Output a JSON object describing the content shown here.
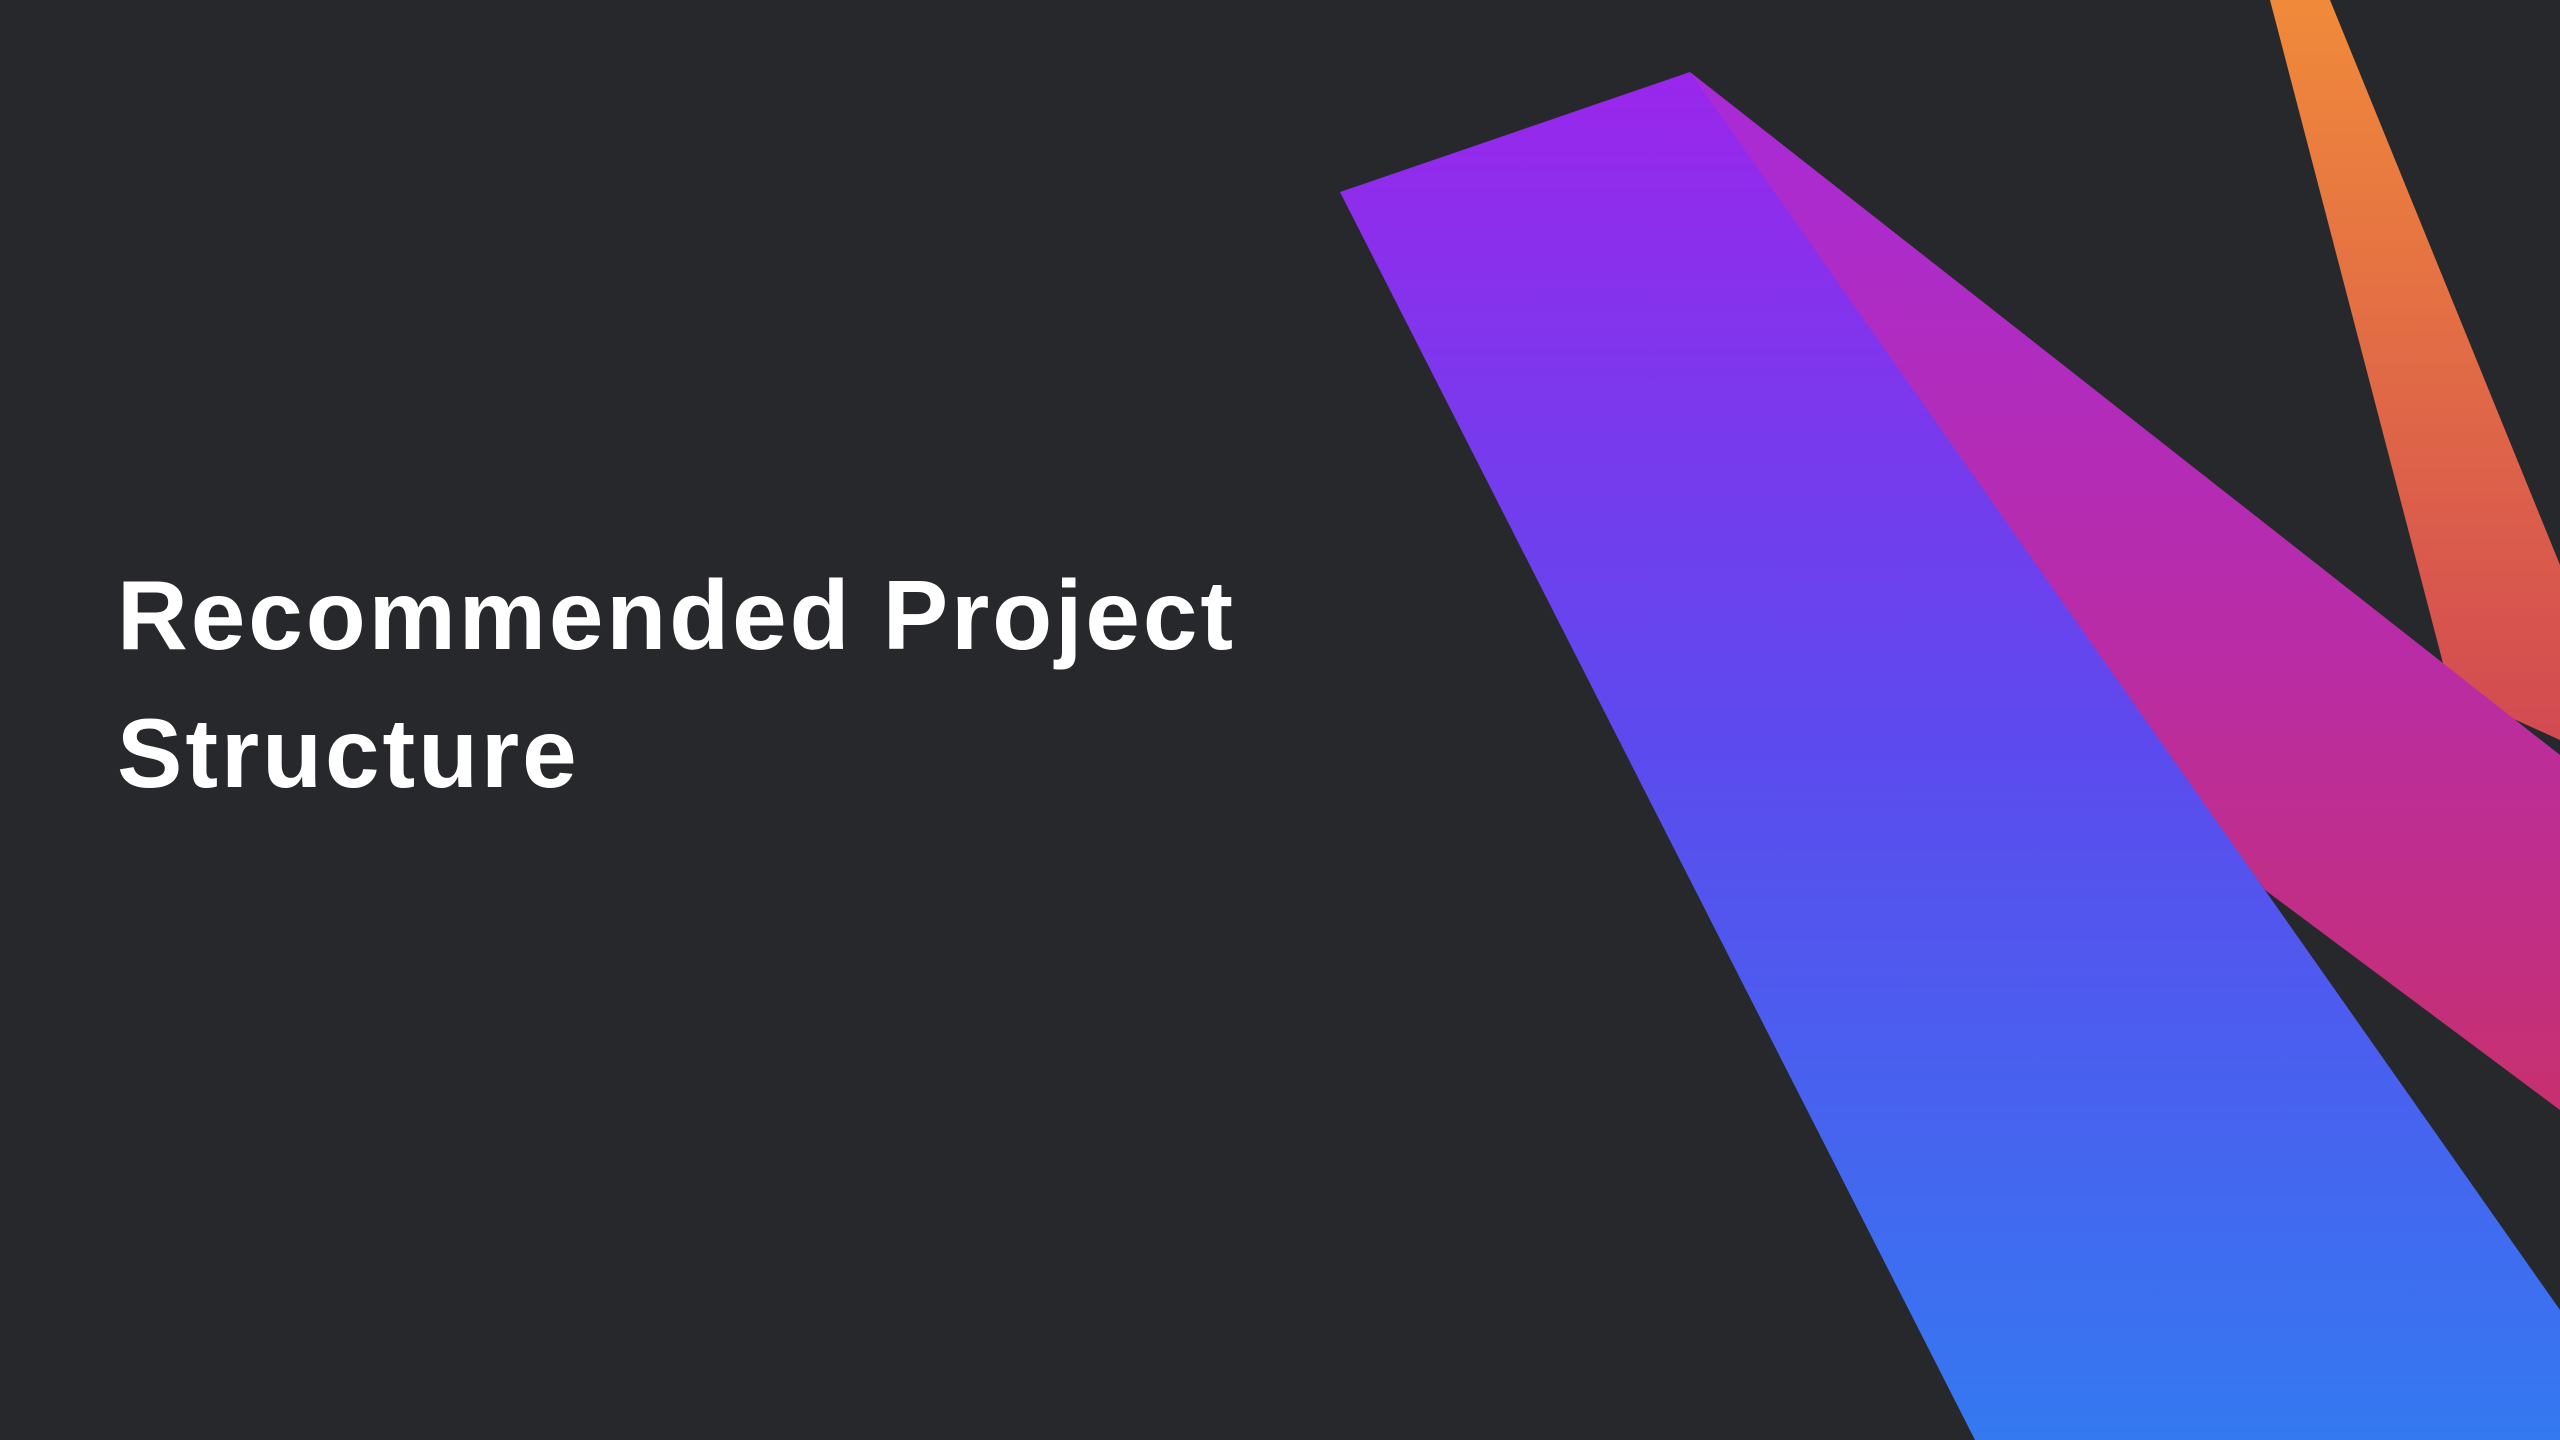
{
  "slide": {
    "title": "Recommended Project Structure",
    "background_color": "#27282c",
    "text_color": "#ffffff"
  },
  "decor": {
    "shapes": [
      "purple-to-blue-band",
      "magenta-band",
      "orange-band"
    ],
    "colors": {
      "purple": "#9a26ec",
      "blue": "#3479f0",
      "violet": "#a82bd8",
      "magenta": "#c7306f",
      "orange": "#f08a3a",
      "red": "#d24a52"
    }
  }
}
